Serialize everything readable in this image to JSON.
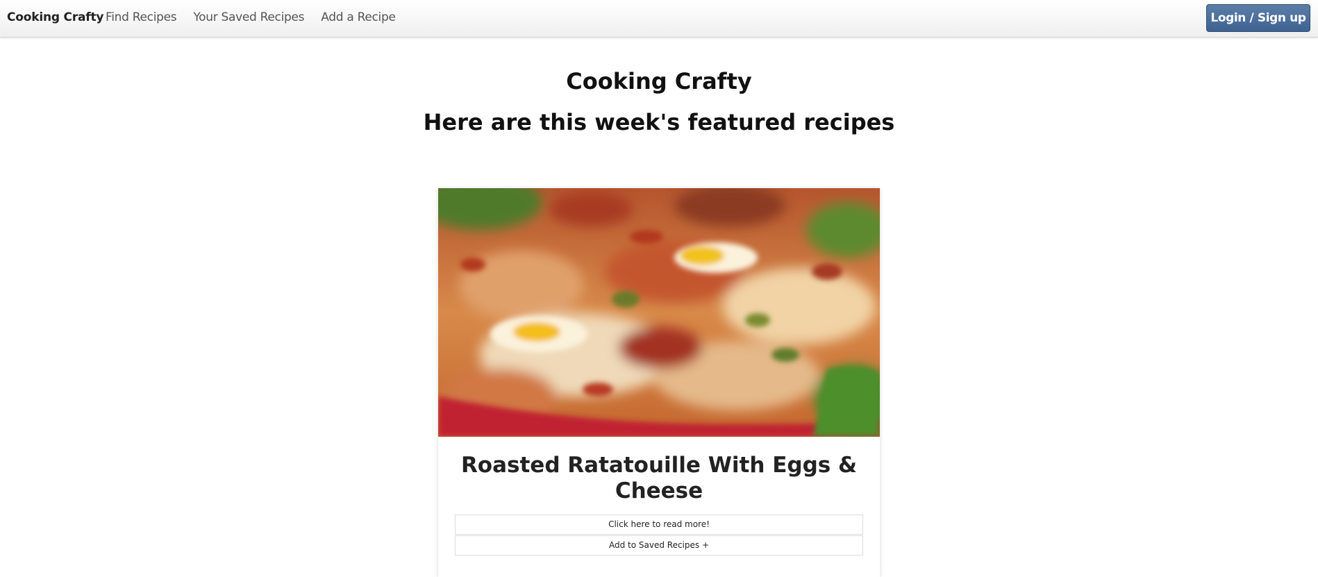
{
  "navbar": {
    "brand": "Cooking Crafty",
    "links": [
      "Find Recipes",
      "Your Saved Recipes",
      "Add a Recipe"
    ],
    "login_label": "Login / Sign up",
    "login_color": "#4a6d99"
  },
  "header": {
    "title": "Cooking Crafty",
    "subtitle": "Here are this week's featured recipes"
  },
  "featured": [
    {
      "title": "Roasted Ratatouille With Eggs & Cheese",
      "read_more_label": "Click here to read more!",
      "save_label": "Add to Saved Recipes +"
    }
  ]
}
